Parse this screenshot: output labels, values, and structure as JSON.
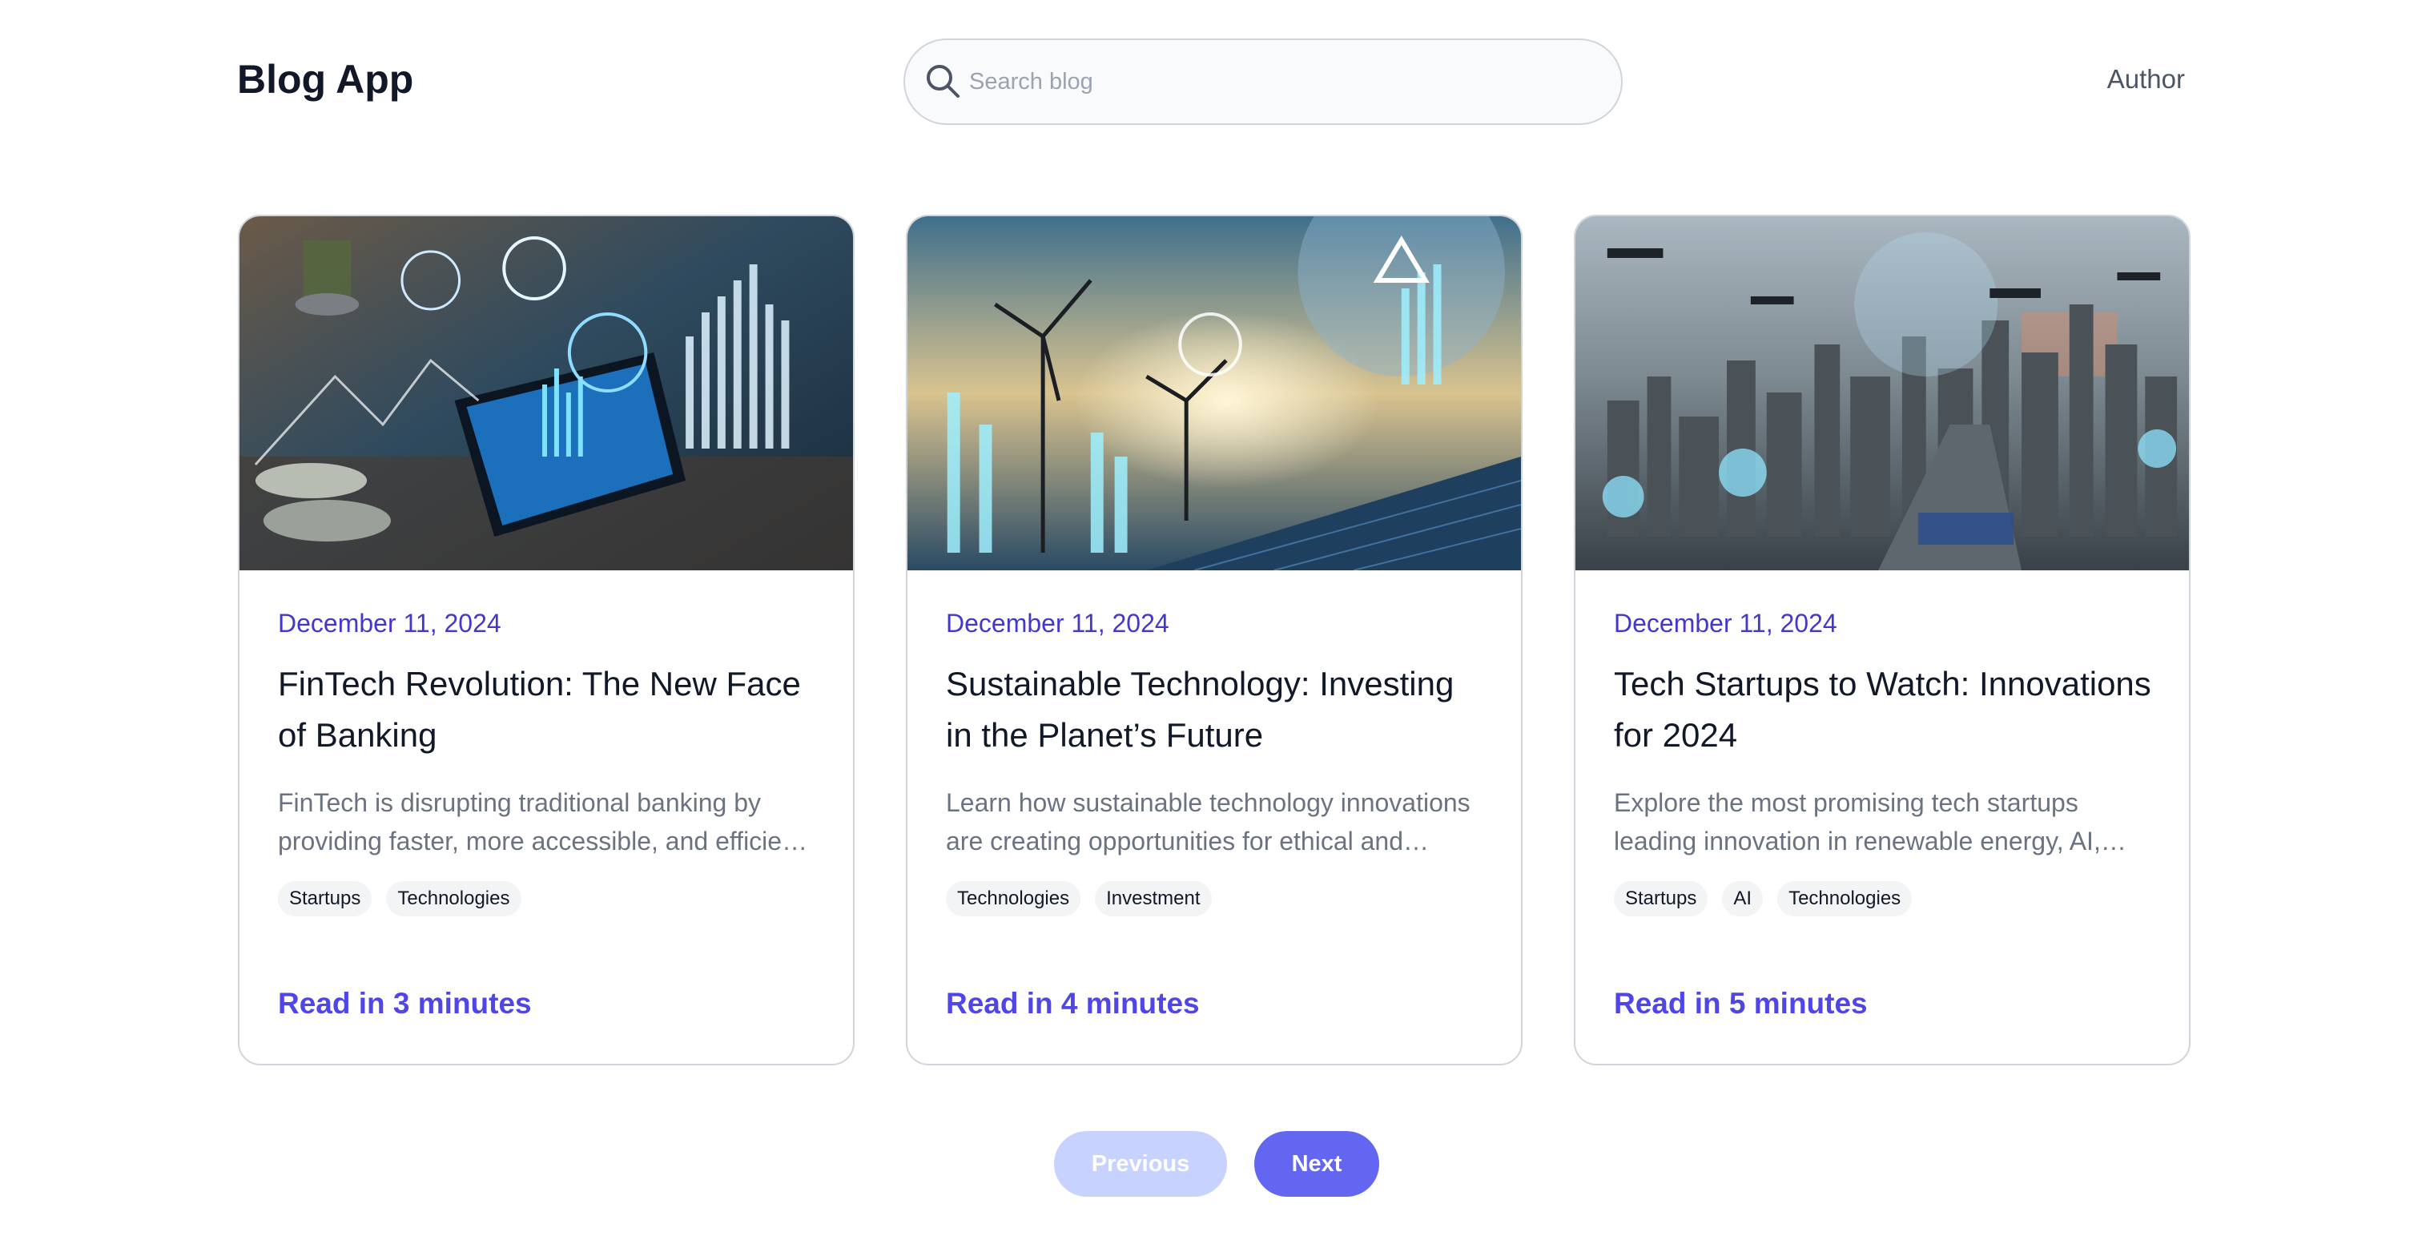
{
  "header": {
    "brand": "Blog App",
    "search_placeholder": "Search blog",
    "search_value": "",
    "author_link": "Author"
  },
  "posts": [
    {
      "date": "December 11, 2024",
      "title": "FinTech Revolution: The New Face of Banking",
      "excerpt": "FinTech is disrupting traditional banking by providing faster, more accessible, and efficie…",
      "tags": [
        "Startups",
        "Technologies"
      ],
      "read_time": "Read in 3 minutes"
    },
    {
      "date": "December 11, 2024",
      "title": "Sustainable Technology: Investing in the Planet’s Future",
      "excerpt": "Learn how sustainable technology innovations are creating opportunities for ethical and…",
      "tags": [
        "Technologies",
        "Investment"
      ],
      "read_time": "Read in 4 minutes"
    },
    {
      "date": "December 11, 2024",
      "title": "Tech Startups to Watch: Innovations for 2024",
      "excerpt": "Explore the most promising tech startups leading innovation in renewable energy, AI,…",
      "tags": [
        "Startups",
        "AI",
        "Technologies"
      ],
      "read_time": "Read in 5 minutes"
    }
  ],
  "pagination": {
    "previous": "Previous",
    "next": "Next"
  },
  "colors": {
    "accent": "#4f46e5",
    "date": "#4338ca",
    "next_button": "#6366f1",
    "previous_button_disabled": "#c7d2fe"
  }
}
